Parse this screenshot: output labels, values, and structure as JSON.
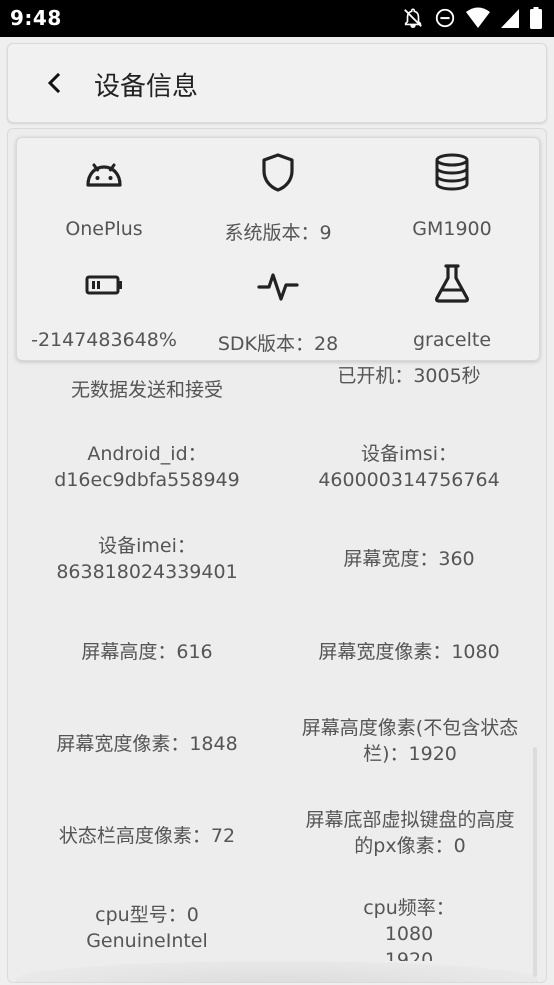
{
  "status_bar": {
    "time": "9:48",
    "icons": [
      "notifications-off-icon",
      "do-not-disturb-icon",
      "wifi-icon",
      "cell-signal-icon",
      "battery-icon"
    ]
  },
  "header": {
    "title": "设备信息",
    "back_icon": "back-chevron-icon"
  },
  "top_grid": [
    {
      "icon": "android-icon",
      "label": "OnePlus"
    },
    {
      "icon": "shield-icon",
      "label": "系统版本：9"
    },
    {
      "icon": "database-icon",
      "label": "GM1900"
    },
    {
      "icon": "battery-icon",
      "label": "-2147483648%"
    },
    {
      "icon": "pulse-icon",
      "label": "SDK版本：28"
    },
    {
      "icon": "flask-icon",
      "label": "gracelte"
    }
  ],
  "info": [
    {
      "text": "无数据发送和接受"
    },
    {
      "text": "已开机：3005秒"
    },
    {
      "text": "Android_id：\nd16ec9dbfa558949"
    },
    {
      "text": "设备imsi：\n460000314756764"
    },
    {
      "text": "设备imei：\n863818024339401"
    },
    {
      "text": "屏幕宽度：360"
    },
    {
      "text": "屏幕高度：616"
    },
    {
      "text": "屏幕宽度像素：1080"
    },
    {
      "text": "屏幕宽度像素：1848"
    },
    {
      "text": "屏幕高度像素(不包含状态\n栏)：1920"
    },
    {
      "text": "状态栏高度像素：72"
    },
    {
      "text": "屏幕底部虚拟键盘的高度\n的px像素：0"
    },
    {
      "text": "cpu型号：0\nGenuineIntel"
    },
    {
      "text": "cpu频率：\n1080\n1920"
    }
  ],
  "colors": {
    "status_bar_bg": "#000000",
    "background": "#efefef",
    "text": "#555555"
  }
}
